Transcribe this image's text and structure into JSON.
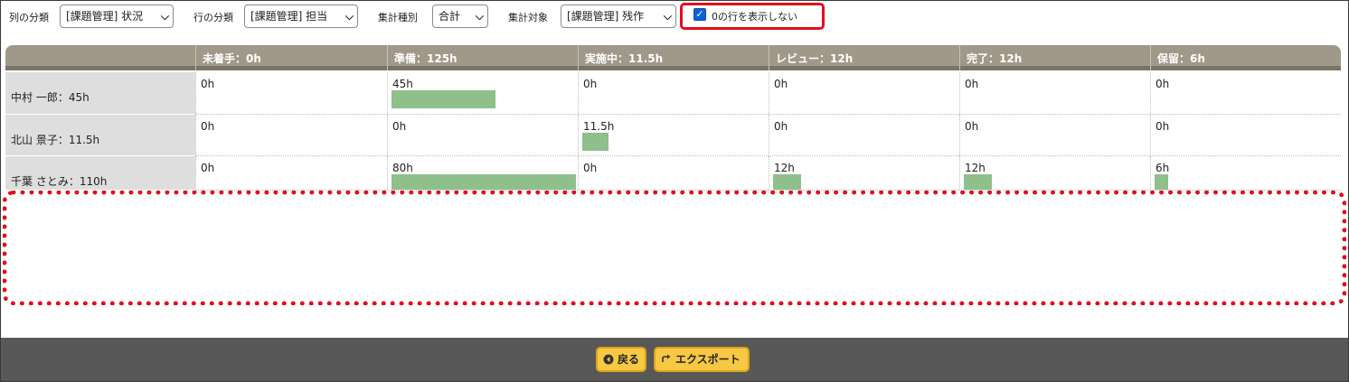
{
  "filters": {
    "column_label": "列の分類",
    "column_value": "[課題管理] 状況",
    "row_label": "行の分類",
    "row_value": "[課題管理] 担当",
    "agg_type_label": "集計種別",
    "agg_type_value": "合計",
    "agg_target_label": "集計対象",
    "agg_target_value": "[課題管理] 残作",
    "hide_zero_label": "0の行を表示しない",
    "hide_zero_checked": true
  },
  "table": {
    "columns": [
      "未着手：0h",
      "準備：125h",
      "実施中：11.5h",
      "レビュー：12h",
      "完了：12h",
      "保留：6h"
    ],
    "rows": [
      {
        "name": "中村 一郎：45h",
        "cells": [
          {
            "text": "0h",
            "value": 0
          },
          {
            "text": "45h",
            "value": 45
          },
          {
            "text": "0h",
            "value": 0
          },
          {
            "text": "0h",
            "value": 0
          },
          {
            "text": "0h",
            "value": 0
          },
          {
            "text": "0h",
            "value": 0
          }
        ]
      },
      {
        "name": "北山 景子：11.5h",
        "cells": [
          {
            "text": "0h",
            "value": 0
          },
          {
            "text": "0h",
            "value": 0
          },
          {
            "text": "11.5h",
            "value": 11.5
          },
          {
            "text": "0h",
            "value": 0
          },
          {
            "text": "0h",
            "value": 0
          },
          {
            "text": "0h",
            "value": 0
          }
        ]
      },
      {
        "name": "千葉 さとみ：110h",
        "cells": [
          {
            "text": "0h",
            "value": 0
          },
          {
            "text": "80h",
            "value": 80
          },
          {
            "text": "0h",
            "value": 0
          },
          {
            "text": "12h",
            "value": 12
          },
          {
            "text": "12h",
            "value": 12
          },
          {
            "text": "6h",
            "value": 6
          }
        ]
      }
    ],
    "bar_max": 80,
    "bar_color": "#8fbf8b"
  },
  "footer": {
    "back_label": "戻る",
    "export_label": "エクスポート"
  },
  "colors": {
    "highlight": "#e0101a",
    "header_bg": "#a09889",
    "footer_bg": "#585858",
    "button_bg": "#f7c843"
  }
}
